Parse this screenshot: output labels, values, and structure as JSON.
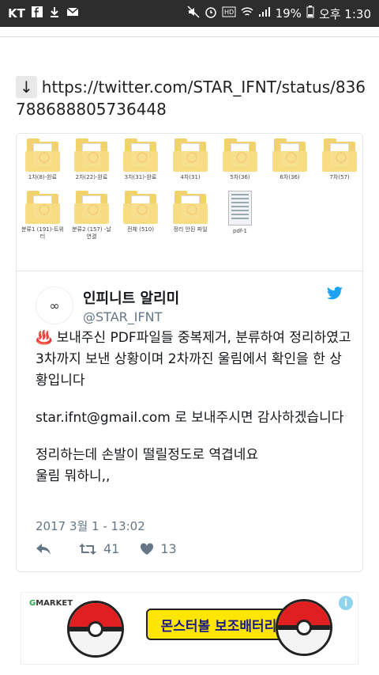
{
  "statusbar": {
    "carrier": "KT",
    "battery": "19%",
    "time": "오후 1:30",
    "icons": [
      "facebook-icon",
      "download-icon",
      "mail-icon",
      "mute-icon",
      "alarm-icon",
      "hd-icon",
      "wifi-icon",
      "signal-icon",
      "battery-icon"
    ]
  },
  "link": {
    "arrow": "↓",
    "url": "https://twitter.com/STAR_IFNT/status/836788688805736448"
  },
  "image": {
    "folders": [
      {
        "label": "1차(8)-완료"
      },
      {
        "label": "2차(22)-완료"
      },
      {
        "label": "3차(31)-완료"
      },
      {
        "label": "4차(31)"
      },
      {
        "label": "5차(36)"
      },
      {
        "label": "6차(36)"
      },
      {
        "label": "7차(57)"
      },
      {
        "label": "분류1 (191)-트위터"
      },
      {
        "label": "분류2 (157) -날 연결"
      },
      {
        "label": "전체 (510)"
      },
      {
        "label": "정리 안된 파일"
      }
    ],
    "doc_label": "pdf-1"
  },
  "tweet": {
    "avatar_text": "∞",
    "display_name": "인피니트 알리미",
    "handle": "@STAR_IFNT",
    "para1": "♨️ 보내주신 PDF파일들 중복제거, 분류하여 정리하였고 3차까지 보낸 상황이며 2차까진 울림에서 확인을 한 상황입니다",
    "para2": "star.ifnt@gmail.com 로 보내주시면 감사하겠습니다",
    "para3": "정리하는데 손발이 떨릴정도로 역겹네요\n울림 뭐하니,,",
    "date": "2017 3월 1 - 13:02",
    "retweets": "41",
    "likes": "13"
  },
  "ad": {
    "brand_prefix": "G",
    "brand": "MARKET",
    "headline": "몬스터볼 보조배터리",
    "info": "i"
  }
}
